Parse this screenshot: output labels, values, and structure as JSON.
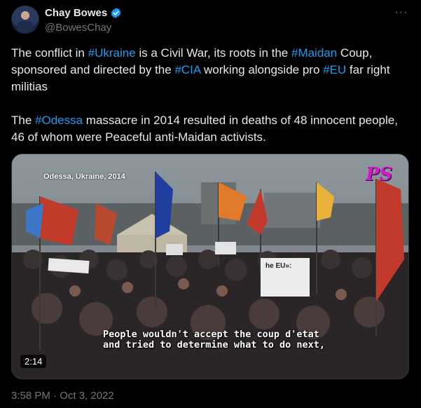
{
  "author": {
    "display_name": "Chay Bowes",
    "handle": "@BowesChay",
    "verified": true,
    "avatar": "avatar"
  },
  "menu": {
    "icon": "more-icon",
    "label": "···"
  },
  "tweet": {
    "paragraph1": [
      {
        "t": "The conflict in "
      },
      {
        "t": "#Ukraine",
        "tag": true
      },
      {
        "t": " is a Civil War, its roots in the "
      },
      {
        "t": "#Maidan",
        "tag": true
      },
      {
        "t": " Coup, sponsored and directed by the "
      },
      {
        "t": "#CIA",
        "tag": true
      },
      {
        "t": " working alongside pro "
      },
      {
        "t": "#EU",
        "tag": true
      },
      {
        "t": " far right militias"
      }
    ],
    "paragraph2": [
      {
        "t": "The "
      },
      {
        "t": "#Odessa",
        "tag": true
      },
      {
        "t": " massacre in 2014 resulted in deaths of 48 innocent people, 46 of whom were Peaceful anti-Maidan activists."
      }
    ]
  },
  "video": {
    "location_caption": "Odessa, Ukraine, 2014",
    "logo": "PS",
    "subtitle": "People wouldn't accept the coup d'etat\nand tried to determine what to do next,",
    "duration": "2:14",
    "sign_text": "he EU»:"
  },
  "timestamp": "3:58 PM · Oct 3, 2022",
  "colors": {
    "link": "#1d9bf0",
    "background": "#000000",
    "secondary": "#71767b"
  }
}
